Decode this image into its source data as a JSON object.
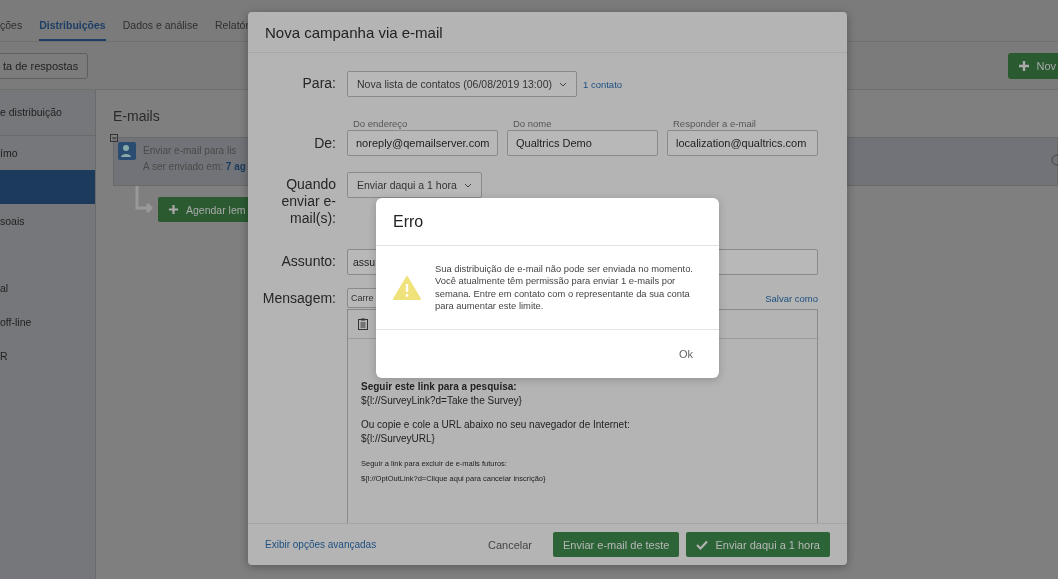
{
  "app": {
    "tabs": [
      {
        "label": "ções",
        "selected": false
      },
      {
        "label": "Distribuições",
        "selected": true
      },
      {
        "label": "Dados e análise",
        "selected": false
      },
      {
        "label": "Relatór",
        "selected": false
      }
    ],
    "toolbar": {
      "left_button": "ta de respostas",
      "right_button": "Nov"
    },
    "sidebar": {
      "header": "e distribuição",
      "items": [
        {
          "label": "ímo",
          "selected": false
        },
        {
          "selected": true
        },
        {
          "label": "soais",
          "selected": false
        },
        {
          "label": "al",
          "selected": false
        },
        {
          "label": "off-line",
          "selected": false
        },
        {
          "label": "R",
          "selected": false
        }
      ]
    },
    "emails": {
      "title": "E-mails",
      "card": {
        "text": "Enviar e-mail para lis",
        "scheduled_label": "A ser enviado em:",
        "scheduled_value": "7 ag"
      },
      "reminder_button": "Agendar lem"
    }
  },
  "campaign_modal": {
    "title": "Nova campanha via e-mail",
    "to": {
      "label": "Para:",
      "value": "Nova lista de contatos (06/08/2019 13:00)",
      "link": "1 contato"
    },
    "from": {
      "label": "De:",
      "fields": [
        {
          "label": "Do endereço",
          "value": "noreply@qemailserver.com"
        },
        {
          "label": "Do nome",
          "value": "Qualtrics Demo"
        },
        {
          "label": "Responder a e-mail",
          "value": "localization@qualtrics.com"
        }
      ]
    },
    "when": {
      "label": "Quando enviar e-mail(s):",
      "value": "Enviar daqui a 1 hora"
    },
    "subject": {
      "label": "Assunto:",
      "value": "assu"
    },
    "message": {
      "label": "Mensagem:",
      "template": "Carre",
      "save_link": "Salvar como",
      "body": [
        {
          "kind": "heading",
          "lines": [
            "Seguir este link para a pesquisa:",
            "${l://SurveyLink?d=Take the Survey}"
          ]
        },
        {
          "kind": "normal",
          "lines": [
            "Ou copie e cole a URL abaixo no seu navegador de Internet:",
            "${l://SurveyURL}"
          ]
        },
        {
          "kind": "small",
          "lines": [
            "Seguir a link para excluir de e-mails futuros:",
            "${l://OptOutLink?d=Clique aqui para cancelar inscrição}"
          ]
        }
      ]
    },
    "footer": {
      "advanced_link": "Exibir opções avançadas",
      "cancel": "Cancelar",
      "test_button": "Enviar e-mail de teste",
      "send_button": "Enviar daqui a 1 hora"
    }
  },
  "error_dialog": {
    "title": "Erro",
    "message": "Sua distribuição de e-mail não pode ser enviada no momento. Você atualmente têm permissão para enviar 1 e-mails por semana. Entre em contato com o representante da sua conta para aumentar este limite.",
    "button": "Ok"
  }
}
